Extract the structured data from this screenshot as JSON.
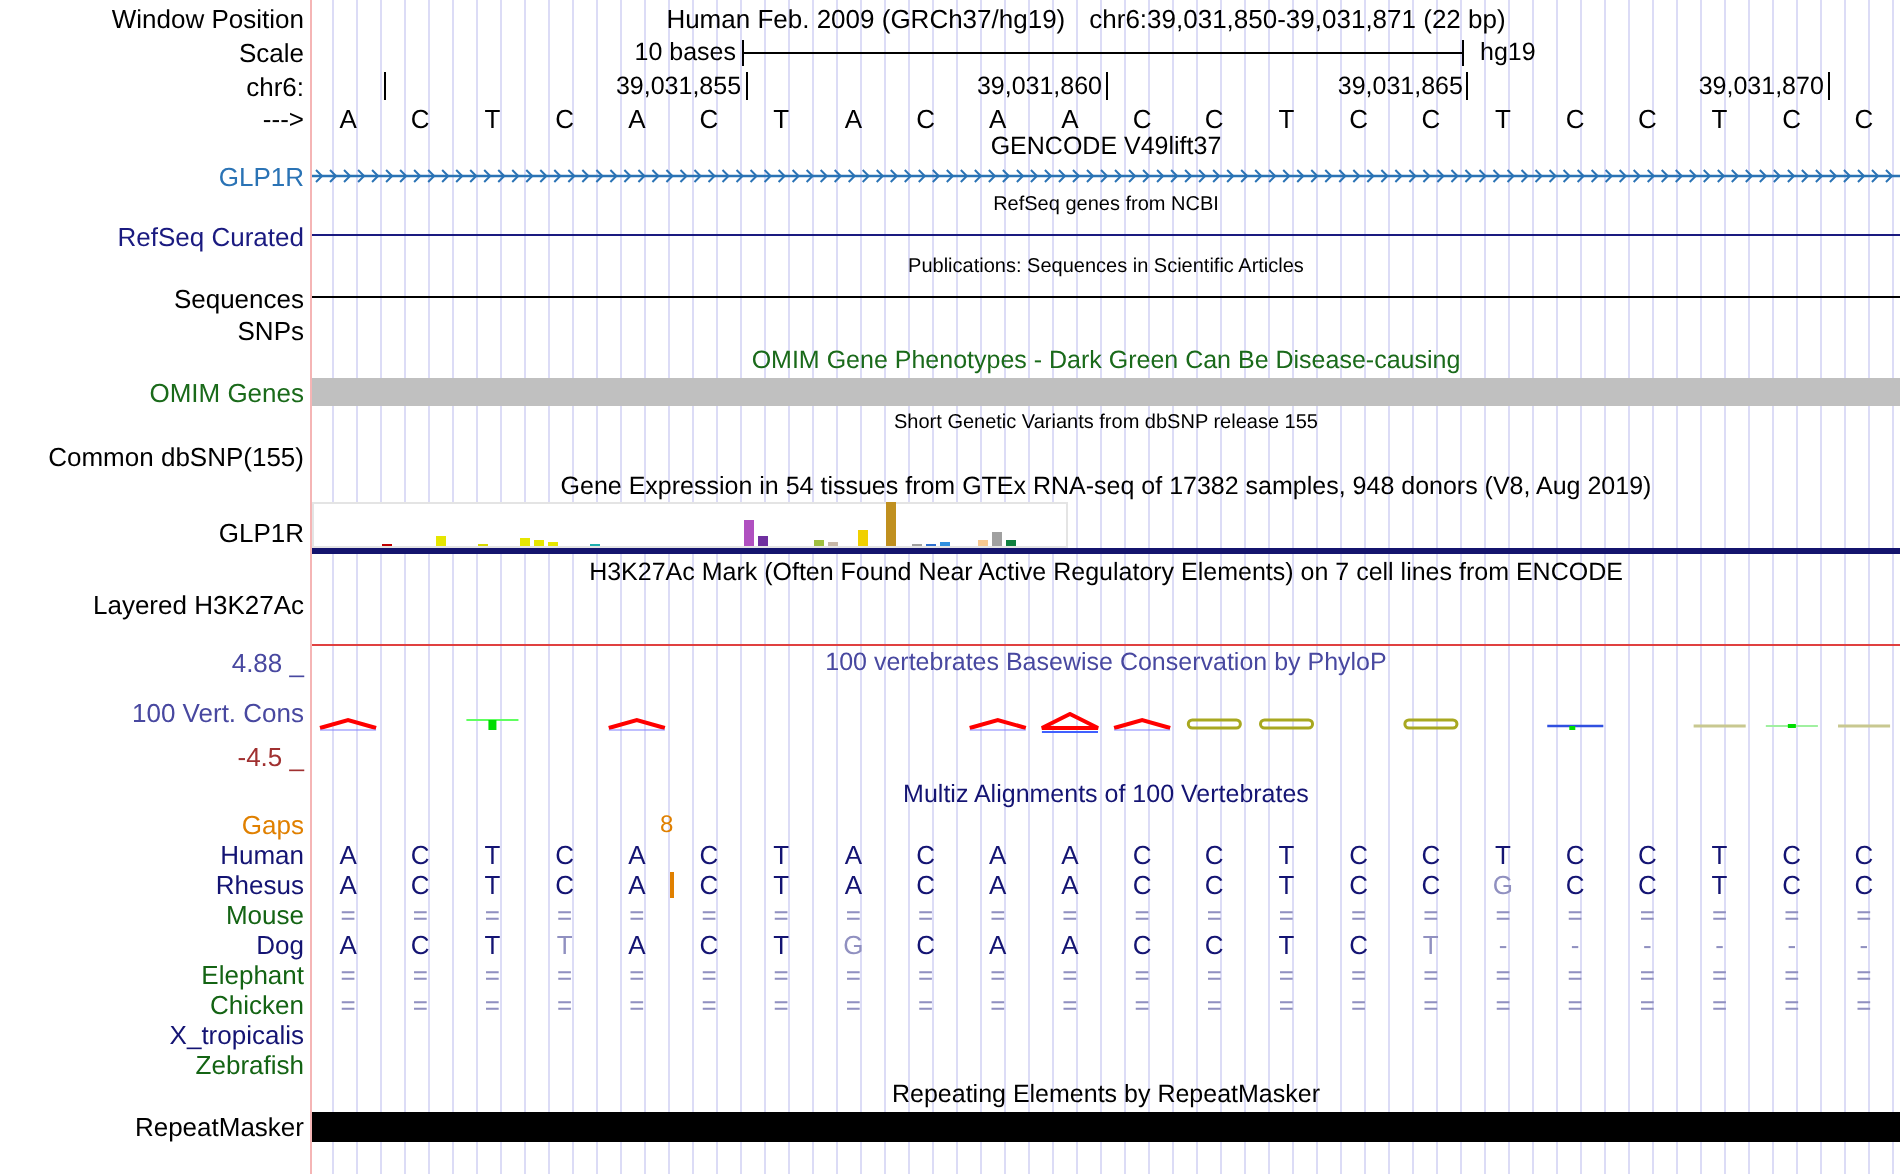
{
  "header": {
    "label": "Window Position",
    "assembly": "Human Feb. 2009 (GRCh37/hg19)",
    "position": "chr6:39,031,850-39,031,871 (22 bp)"
  },
  "scale": {
    "label": "Scale",
    "span": "10 bases",
    "assembly": "hg19"
  },
  "ruler": {
    "label": "chr6:",
    "ticks": [
      "39,031,855",
      "39,031,860",
      "39,031,865",
      "39,031,870"
    ]
  },
  "sequence": {
    "label": "--->",
    "bases": [
      "A",
      "C",
      "T",
      "C",
      "A",
      "C",
      "T",
      "A",
      "C",
      "A",
      "A",
      "C",
      "C",
      "T",
      "C",
      "C",
      "T",
      "C",
      "C",
      "T",
      "C",
      "C"
    ]
  },
  "tracks": [
    {
      "kind": "gencode",
      "title": "GENCODE V49lift37",
      "label": "GLP1R"
    },
    {
      "kind": "refseq",
      "title": "RefSeq genes from NCBI",
      "label": "RefSeq Curated"
    },
    {
      "kind": "publications",
      "title": "Publications: Sequences in Scientific Articles",
      "label": "Sequences"
    },
    {
      "kind": "empty",
      "label": "SNPs"
    },
    {
      "kind": "omim",
      "title": "OMIM Gene Phenotypes - Dark Green Can Be Disease-causing",
      "label": "OMIM Genes"
    },
    {
      "kind": "dbsnp",
      "title": "Short Genetic Variants from dbSNP release 155",
      "label": "Common dbSNP(155)"
    },
    {
      "kind": "gtex",
      "title": "Gene Expression in 54 tissues from GTEx RNA-seq of 17382 samples, 948 donors (V8, Aug 2019)",
      "label": "GLP1R"
    },
    {
      "kind": "h3k27ac",
      "title": "H3K27Ac Mark (Often Found Near Active Regulatory Elements) on 7 cell lines from ENCODE",
      "label": "Layered H3K27Ac"
    },
    {
      "kind": "phylop",
      "title": "100 vertebrates Basewise Conservation by PhyloP",
      "label": "100 Vert. Cons",
      "max": "4.88 _",
      "min": "-4.5 _"
    },
    {
      "kind": "multiz",
      "title": "Multiz Alignments of 100 Vertebrates",
      "gaps_label": "Gaps",
      "gap_count": "8",
      "species": [
        {
          "name": "Human",
          "color": "#141473",
          "bases": [
            "A",
            "C",
            "T",
            "C",
            "A",
            "C",
            "T",
            "A",
            "C",
            "A",
            "A",
            "C",
            "C",
            "T",
            "C",
            "C",
            "T",
            "C",
            "C",
            "T",
            "C",
            "C"
          ]
        },
        {
          "name": "Rhesus",
          "color": "#141473",
          "gap": true,
          "bases": [
            "A",
            "C",
            "T",
            "C",
            "A",
            "C",
            "T",
            "A",
            "C",
            "A",
            "A",
            "C",
            "C",
            "T",
            "C",
            "C",
            "G",
            "C",
            "C",
            "T",
            "C",
            "C"
          ]
        },
        {
          "name": "Mouse",
          "color": "#146414",
          "bases": [
            "=",
            "=",
            "=",
            "=",
            "=",
            "=",
            "=",
            "=",
            "=",
            "=",
            "=",
            "=",
            "=",
            "=",
            "=",
            "=",
            "=",
            "=",
            "=",
            "=",
            "=",
            "="
          ]
        },
        {
          "name": "Dog",
          "color": "#141473",
          "bases": [
            "A",
            "C",
            "T",
            "T",
            "A",
            "C",
            "T",
            "G",
            "C",
            "A",
            "A",
            "C",
            "C",
            "T",
            "C",
            "T",
            "-",
            "-",
            "-",
            "-",
            "-",
            "-"
          ]
        },
        {
          "name": "Elephant",
          "color": "#146414",
          "bases": [
            "=",
            "=",
            "=",
            "=",
            "=",
            "=",
            "=",
            "=",
            "=",
            "=",
            "=",
            "=",
            "=",
            "=",
            "=",
            "=",
            "=",
            "=",
            "=",
            "=",
            "=",
            "="
          ]
        },
        {
          "name": "Chicken",
          "color": "#146414",
          "bases": [
            "=",
            "=",
            "=",
            "=",
            "=",
            "=",
            "=",
            "=",
            "=",
            "=",
            "=",
            "=",
            "=",
            "=",
            "=",
            "=",
            "=",
            "=",
            "=",
            "=",
            "=",
            "="
          ]
        },
        {
          "name": "X_tropicalis",
          "color": "#141473"
        },
        {
          "name": "Zebrafish",
          "color": "#146414"
        }
      ]
    },
    {
      "kind": "rmsk",
      "title": "Repeating Elements by RepeatMasker",
      "label": "RepeatMasker"
    }
  ]
}
